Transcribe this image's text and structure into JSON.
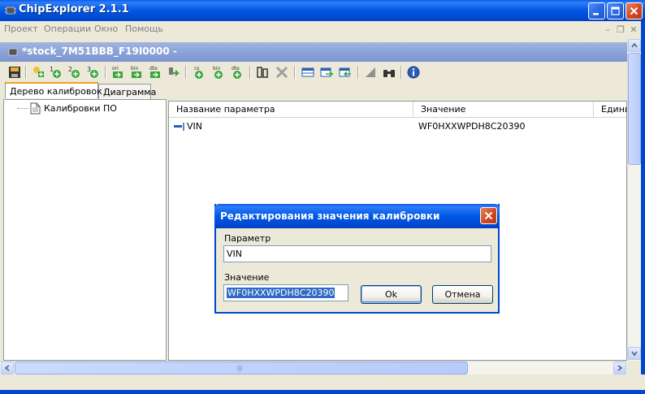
{
  "app": {
    "title": "ChipExplorer 2.1.1",
    "icon": "chip-icon"
  },
  "menu": {
    "items": [
      {
        "label": "Проект"
      },
      {
        "label": "Операции"
      },
      {
        "label": "Окно"
      },
      {
        "label": "Помощь"
      }
    ],
    "enabled": false
  },
  "document": {
    "title": "*stock_7M51BBB_F19I0000 -"
  },
  "toolbar": {
    "tools": [
      {
        "icon": "save-icon"
      },
      {
        "icon": "new-calibration-icon"
      },
      {
        "icon": "add-1-icon",
        "label": "1"
      },
      {
        "icon": "add-2-icon",
        "label": "2"
      },
      {
        "icon": "add-3-icon",
        "label": "3"
      },
      {
        "icon": "export-ori-icon",
        "label": "ori"
      },
      {
        "icon": "export-bin-icon",
        "label": "bin"
      },
      {
        "icon": "export-dte-icon",
        "label": "dte"
      },
      {
        "icon": "write-icon"
      },
      {
        "icon": "checksum-icon",
        "label": "cs"
      },
      {
        "icon": "import-bin-icon",
        "label": "bin"
      },
      {
        "icon": "import-dte-icon",
        "label": "dte"
      },
      {
        "icon": "compare-icon"
      },
      {
        "icon": "disabled-tool-icon"
      },
      {
        "icon": "table-icon"
      },
      {
        "icon": "table-import-icon"
      },
      {
        "icon": "table-export-icon"
      },
      {
        "icon": "triangle-tool-icon"
      },
      {
        "icon": "binoculars-icon"
      },
      {
        "icon": "info-icon"
      }
    ]
  },
  "tabs": [
    {
      "label": "Дерево калибровок",
      "active": true
    },
    {
      "label": "Диаграмма",
      "active": false
    }
  ],
  "tree": {
    "items": [
      {
        "label": "Калибровки ПО",
        "icon": "document-icon"
      }
    ]
  },
  "grid": {
    "columns": [
      {
        "label": "Название параметра"
      },
      {
        "label": "Значение"
      },
      {
        "label": "Едини"
      }
    ],
    "rows": [
      {
        "name": "VIN",
        "value": "WF0HXXWPDH8C20390",
        "unit": ""
      }
    ]
  },
  "dialog": {
    "title": "Редактирования значения калибровки",
    "param_label": "Параметр",
    "param_value": "VIN",
    "value_label": "Значение",
    "value_value": "WF0HXXWPDH8C20390",
    "ok_label": "Ok",
    "cancel_label": "Отмена"
  },
  "colors": {
    "xp_blue": "#0058e4",
    "child_title": "#8ea6da",
    "selection": "#316ac5",
    "close_red": "#d2451f"
  }
}
